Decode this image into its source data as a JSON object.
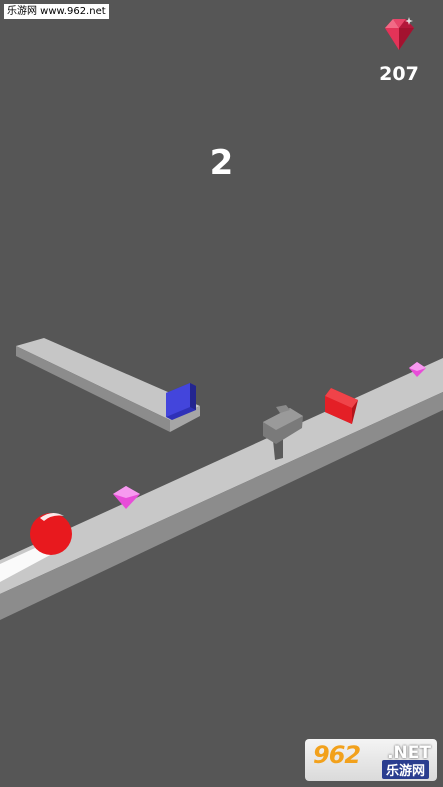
{
  "watermark_top": "乐游网 www.962.net",
  "score": "2",
  "gem_counter": {
    "count": "207",
    "icon": "ruby-gem-icon"
  },
  "watermark_logo": {
    "brand": "962",
    "suffix": ".NET",
    "chinese": "乐游网"
  },
  "colors": {
    "background": "#565656",
    "track_top": "#c7c7c7",
    "track_side": "#8e8e8e",
    "ball": "#e8191e",
    "gem_pink": "#ee55e0",
    "gate_blue": "#3a3ccf",
    "gate_red": "#dc1e25",
    "counter_gem": "#d9254a"
  }
}
